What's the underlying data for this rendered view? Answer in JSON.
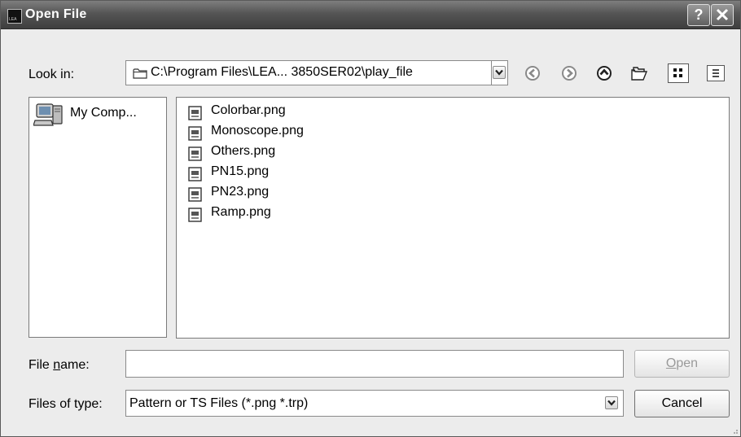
{
  "window": {
    "title": "Open File",
    "help_label": "?"
  },
  "lookin": {
    "label": "Look in:",
    "path": "C:\\Program Files\\LEA... 3850SER02\\play_file"
  },
  "places": {
    "items": [
      {
        "label": "My Comp..."
      }
    ]
  },
  "files": [
    {
      "name": "Colorbar.png"
    },
    {
      "name": "Monoscope.png"
    },
    {
      "name": "Others.png"
    },
    {
      "name": "PN15.png"
    },
    {
      "name": "PN23.png"
    },
    {
      "name": "Ramp.png"
    }
  ],
  "filename": {
    "label_pre": "File ",
    "label_accel": "n",
    "label_post": "ame:",
    "value": ""
  },
  "filetype": {
    "label": "Files of type:",
    "selected": "Pattern or TS Files (*.png *.trp)"
  },
  "buttons": {
    "open_accel": "O",
    "open_rest": "pen",
    "cancel": "Cancel"
  },
  "colors": {
    "titlebar": "#4a4a4a",
    "dialog_bg": "#ececec",
    "disabled_text": "#9a9a9a"
  }
}
